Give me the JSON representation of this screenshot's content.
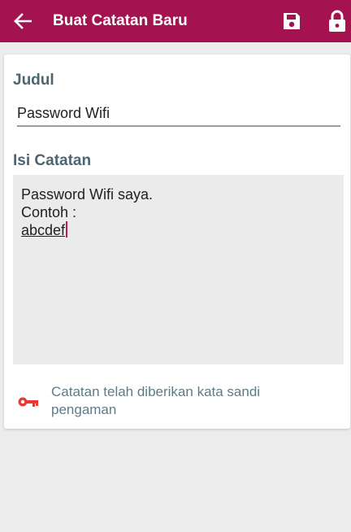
{
  "appbar": {
    "title": "Buat Catatan Baru",
    "back_icon": "arrow-left-icon",
    "save_icon": "save-icon",
    "lock_icon": "lock-icon",
    "background_color": "#a4134f"
  },
  "form": {
    "title_label": "Judul",
    "title_value": "Password Wifi",
    "content_label": "Isi Catatan",
    "content_lines": [
      "Password Wifi saya.",
      "Contoh :",
      "abcdef"
    ]
  },
  "notice": {
    "icon": "key-icon",
    "icon_color": "#e53935",
    "text_line1": "Catatan telah diberikan kata sandi",
    "text_line2": "pengaman"
  }
}
